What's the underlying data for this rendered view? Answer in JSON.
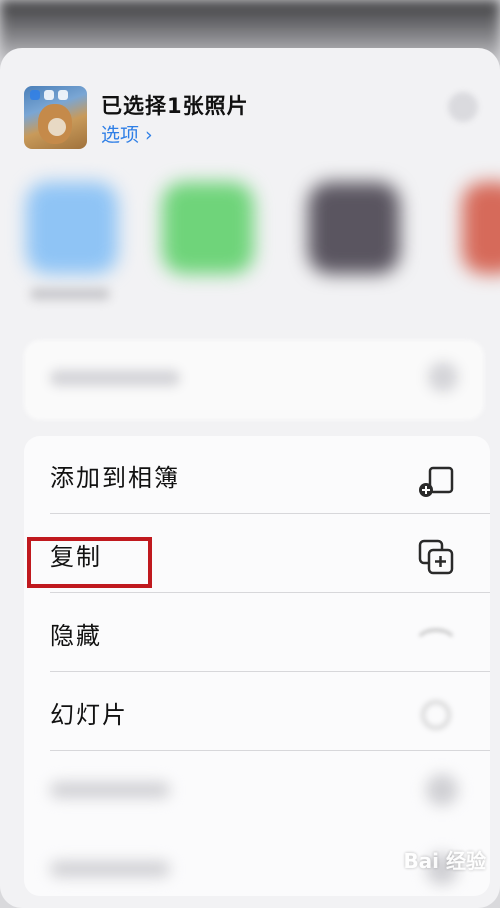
{
  "share_header": {
    "title": "已选择1张照片",
    "options_label": "选项 ›"
  },
  "menu": {
    "items": [
      {
        "label": "添加到相簿",
        "icon": "add-to-album-icon"
      },
      {
        "label": "复制",
        "icon": "copy-icon"
      },
      {
        "label": "隐藏",
        "icon": "hide-icon"
      },
      {
        "label": "幻灯片",
        "icon": "slideshow-icon"
      }
    ]
  },
  "colors": {
    "accent": "#2f7fe6",
    "highlight": "#c0191e"
  },
  "watermark": "Bai 经验"
}
